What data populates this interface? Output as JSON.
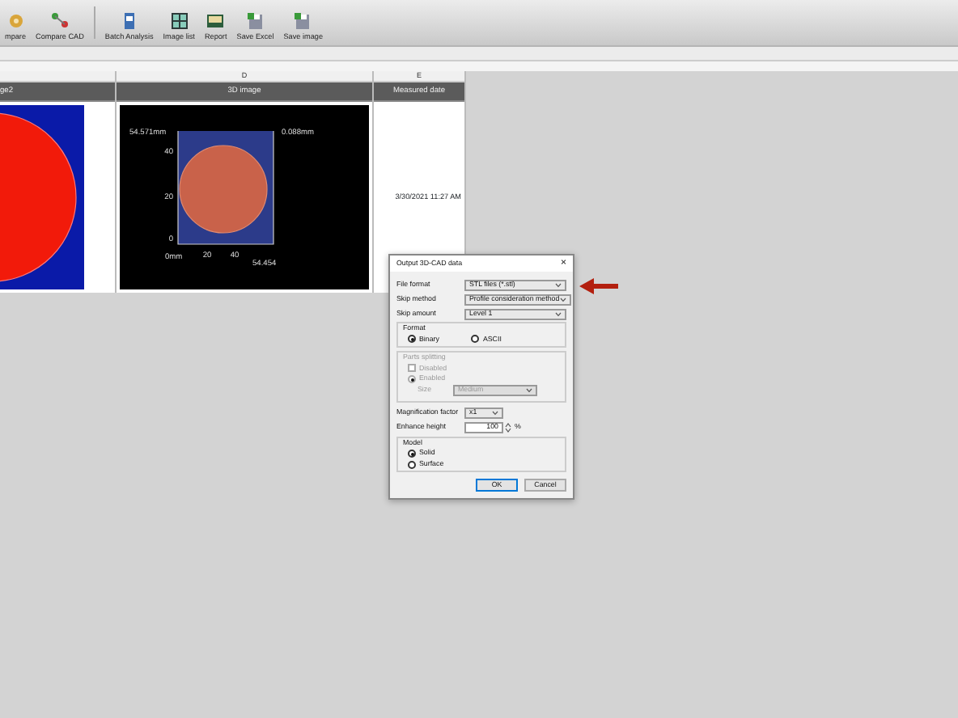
{
  "toolbar": {
    "items": [
      {
        "label": "mpare",
        "kind": "gears"
      },
      {
        "label": "Compare CAD",
        "kind": "cad"
      },
      {
        "label": "Batch Analysis",
        "kind": "batch"
      },
      {
        "label": "Image list",
        "kind": "grid"
      },
      {
        "label": "Report",
        "kind": "report"
      },
      {
        "label": "Save Excel",
        "kind": "save"
      },
      {
        "label": "Save image",
        "kind": "save"
      }
    ]
  },
  "sheet": {
    "columns": [
      {
        "header": "ge2"
      },
      {
        "letter": "D",
        "header": "3D image"
      },
      {
        "letter": "E",
        "header": "Measured date"
      }
    ],
    "row": {
      "image_labels": {
        "top_left": "54.571mm",
        "top_right": "0.088mm",
        "y_ticks": [
          "40",
          "20",
          "0"
        ],
        "origin": "0mm",
        "x_ticks": [
          "20",
          "40"
        ],
        "x_end": "54.454"
      },
      "measured_date": "3/30/2021 11:27 AM"
    }
  },
  "dialog": {
    "title": "Output 3D-CAD data",
    "close": "×",
    "selects": [
      {
        "label": "File format",
        "value": "STL files (*.stl)"
      },
      {
        "label": "Skip method",
        "value": "Profile consideration method"
      },
      {
        "label": "Skip amount",
        "value": "Level 1"
      }
    ],
    "format": {
      "title": "Format",
      "options": [
        {
          "label": "Binary",
          "selected": true
        },
        {
          "label": "ASCII",
          "selected": false
        }
      ]
    },
    "parts_splitting": {
      "title": "Parts splitting",
      "disabled": true,
      "check": {
        "label": "Disabled",
        "checked": false
      },
      "radio": {
        "label": "Enabled",
        "selected": true
      },
      "size": {
        "label": "Size",
        "value": "Medium"
      }
    },
    "magnification": {
      "label": "Magnification factor",
      "value": "x1"
    },
    "enhance": {
      "label": "Enhance height",
      "value": "100",
      "unit": "%"
    },
    "model": {
      "title": "Model",
      "options": [
        {
          "label": "Solid",
          "selected": true
        },
        {
          "label": "Surface",
          "selected": false
        }
      ]
    },
    "buttons": [
      {
        "label": "OK",
        "default": true
      },
      {
        "label": "Cancel",
        "default": false
      }
    ]
  }
}
